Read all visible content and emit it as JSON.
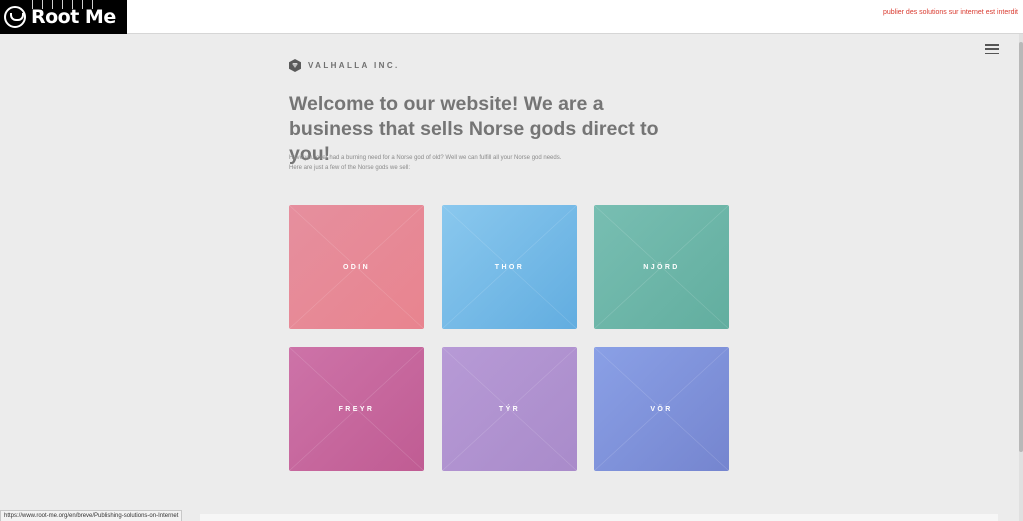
{
  "banner": {
    "logo_text": "Root Me",
    "warning": "publier des solutions sur internet est interdit"
  },
  "menu": {
    "icon": "hamburger-menu-icon"
  },
  "brand": {
    "name": "VALHALLA INC.",
    "icon": "gem-hexagon-icon"
  },
  "hero": {
    "headline": "Welcome to our website! We are a business that sells Norse gods direct to you!",
    "intro_line1": "Have you ever had a burning need for a Norse god of old? Well we can fulfill all your Norse god needs.",
    "intro_line2": "Here are just a few of the Norse gods we sell:"
  },
  "gods": [
    {
      "name": "ODIN",
      "color": "#e8899a"
    },
    {
      "name": "THOR",
      "color": "#74bbe8"
    },
    {
      "name": "NJÖRD",
      "color": "#6db6a8"
    },
    {
      "name": "FREYR",
      "color": "#c8689e"
    },
    {
      "name": "TÝR",
      "color": "#b093d0"
    },
    {
      "name": "VÖR",
      "color": "#8094dc"
    }
  ],
  "status": {
    "url": "https://www.root-me.org/en/breve/Publishing-solutions-on-Internet"
  },
  "colors": {
    "background": "#ececec",
    "warning": "#d93a2f",
    "headline": "#757575"
  }
}
